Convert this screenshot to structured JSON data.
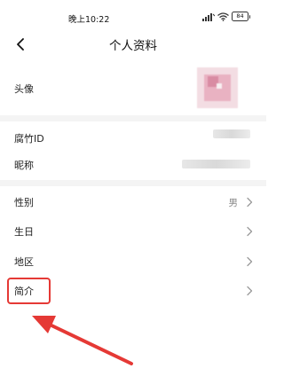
{
  "status_bar": {
    "time": "晚上10:22",
    "battery": "84"
  },
  "header": {
    "title": "个人资料",
    "back_icon": "chevron-left-icon"
  },
  "rows": {
    "avatar_label": "头像",
    "id_label": "腐竹ID",
    "nickname_label": "昵称",
    "gender_label": "性别",
    "gender_value": "男",
    "birthday_label": "生日",
    "region_label": "地区",
    "bio_label": "简介"
  },
  "annotation": {
    "highlight_color": "#e53935"
  }
}
